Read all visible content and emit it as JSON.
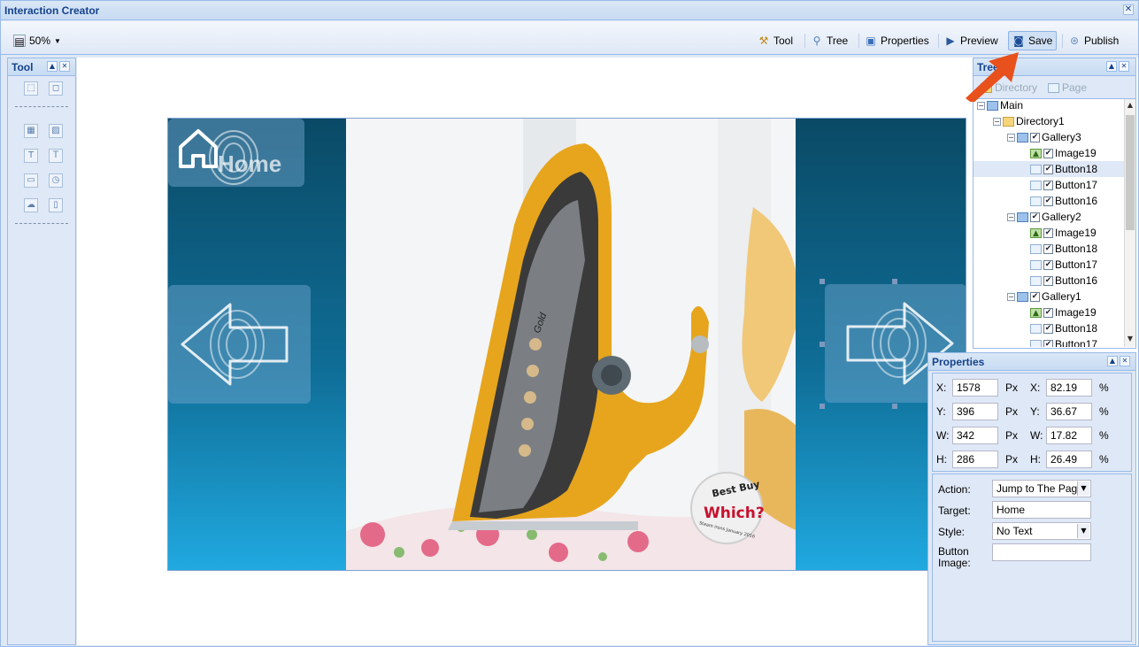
{
  "window": {
    "title": "Interaction Creator",
    "close_glyph": "✕"
  },
  "toolbar": {
    "zoom": "50%",
    "items": [
      {
        "label": "Tool",
        "icon": "tool-icon"
      },
      {
        "label": "Tree",
        "icon": "tree-icon"
      },
      {
        "label": "Properties",
        "icon": "properties-icon"
      },
      {
        "label": "Preview",
        "icon": "preview-icon"
      },
      {
        "label": "Save",
        "icon": "save-icon"
      },
      {
        "label": "Publish",
        "icon": "publish-icon"
      }
    ]
  },
  "tool_panel": {
    "title": "Tool"
  },
  "stage": {
    "home_label": "Home",
    "badge_top": "Best Buy",
    "badge_main": "Which?",
    "badge_sub": "Steam irons January 2016",
    "iron_brand": "Gold"
  },
  "tree_panel": {
    "title": "Tree",
    "tabs": [
      "Directory",
      "Page"
    ],
    "root": "Main",
    "items": [
      {
        "label": "Directory1",
        "type": "folder",
        "level": 1,
        "selected": false
      },
      {
        "label": "Gallery3",
        "type": "gallery",
        "level": 2,
        "selected": false
      },
      {
        "label": "Image19",
        "type": "image",
        "level": 3,
        "selected": false
      },
      {
        "label": "Button18",
        "type": "button",
        "level": 3,
        "selected": true
      },
      {
        "label": "Button17",
        "type": "button",
        "level": 3,
        "selected": false
      },
      {
        "label": "Button16",
        "type": "button",
        "level": 3,
        "selected": false
      },
      {
        "label": "Gallery2",
        "type": "gallery",
        "level": 2,
        "selected": false
      },
      {
        "label": "Image19",
        "type": "image",
        "level": 3,
        "selected": false
      },
      {
        "label": "Button18",
        "type": "button",
        "level": 3,
        "selected": false
      },
      {
        "label": "Button17",
        "type": "button",
        "level": 3,
        "selected": false
      },
      {
        "label": "Button16",
        "type": "button",
        "level": 3,
        "selected": false
      },
      {
        "label": "Gallery1",
        "type": "gallery",
        "level": 2,
        "selected": false
      },
      {
        "label": "Image19",
        "type": "image",
        "level": 3,
        "selected": false
      },
      {
        "label": "Button18",
        "type": "button",
        "level": 3,
        "selected": false
      },
      {
        "label": "Button17",
        "type": "button",
        "level": 3,
        "selected": false
      }
    ]
  },
  "properties": {
    "title": "Properties",
    "rows": [
      {
        "label": "X:",
        "px": "1578",
        "unit": "Px",
        "pct_label": "X:",
        "pct": "82.19",
        "pct_unit": "%"
      },
      {
        "label": "Y:",
        "px": "396",
        "unit": "Px",
        "pct_label": "Y:",
        "pct": "36.67",
        "pct_unit": "%"
      },
      {
        "label": "W:",
        "px": "342",
        "unit": "Px",
        "pct_label": "W:",
        "pct": "17.82",
        "pct_unit": "%"
      },
      {
        "label": "H:",
        "px": "286",
        "unit": "Px",
        "pct_label": "H:",
        "pct": "26.49",
        "pct_unit": "%"
      }
    ],
    "action_label": "Action:",
    "action_value": "Jump to The Page",
    "target_label": "Target:",
    "target_value": "Home",
    "style_label": "Style:",
    "style_value": "No Text",
    "button_image_label_1": "Button",
    "button_image_label_2": "Image:",
    "button_image_value": ""
  },
  "colors": {
    "accent_arrow": "#e8501c",
    "panel_bg": "#dfe8f6",
    "panel_border": "#99bbe8",
    "header_text": "#15428b"
  }
}
